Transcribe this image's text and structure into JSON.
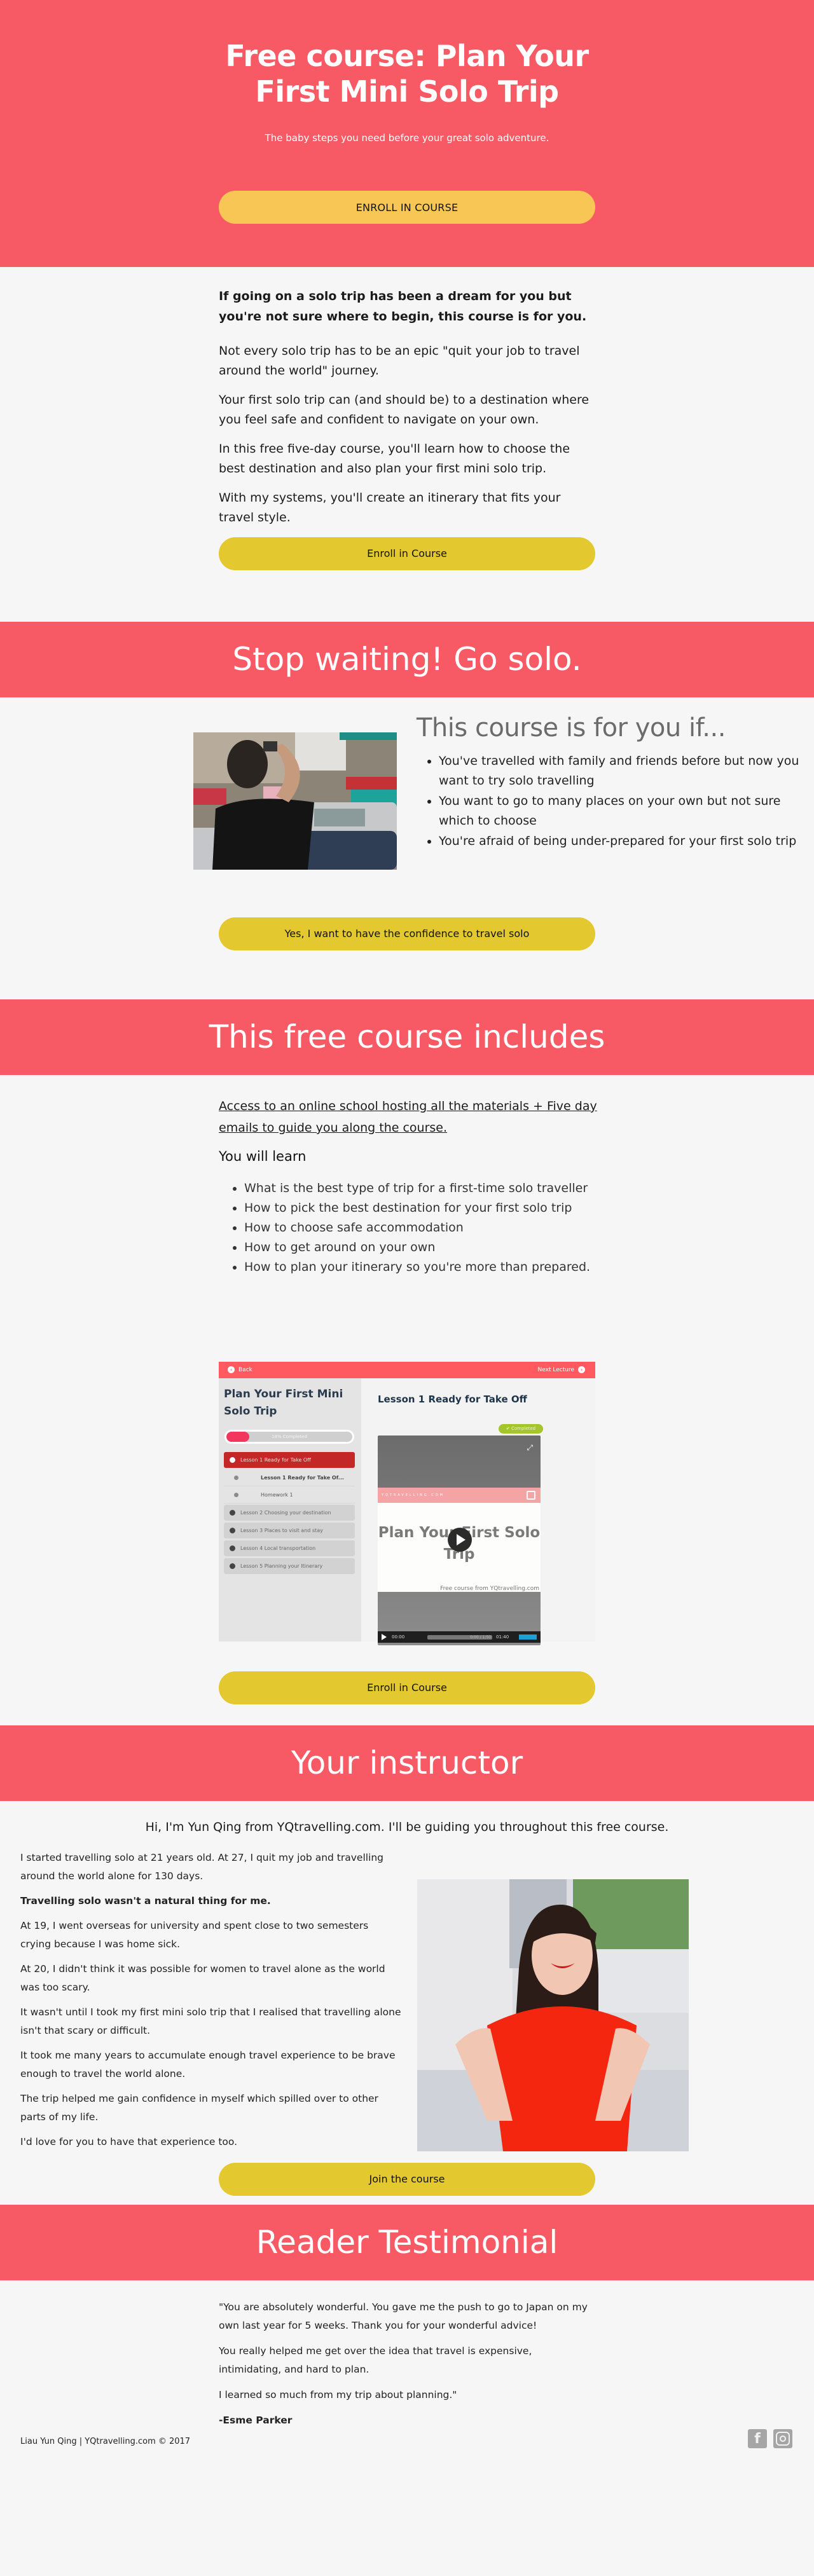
{
  "colors": {
    "brand_coral": "#f75a64",
    "hero_button": "#f7c655",
    "cta_button": "#e4c82f",
    "background": "#f6f6f6"
  },
  "hero": {
    "title": "Free course: Plan Your First Mini Solo Trip",
    "subtitle": "The baby steps you need before your great solo adventure.",
    "cta_label": "ENROLL IN COURSE"
  },
  "intro": {
    "lead": "If going on a solo trip has been a dream for you but you're not sure where to begin, this course is for you.",
    "paragraphs": [
      "Not every solo trip has to be an epic \"quit your job to travel around the world\" journey.",
      "Your first solo trip can (and should be) to a destination where you feel safe and confident to navigate on your own.",
      "In this free five-day course, you'll learn how to choose the best destination and also plan your first mini solo trip.",
      "With my systems, you'll create an itinerary that fits your travel style."
    ],
    "cta_label": "Enroll in Course"
  },
  "banner_go_solo": {
    "title": "Stop waiting! Go solo."
  },
  "for_you": {
    "heading": "This course is for you if...",
    "items": [
      "You've travelled with family and friends before but now you want to try solo travelling",
      "You want to go to many places on your own but not sure which to choose",
      "You're afraid of being under-prepared for your first solo trip"
    ],
    "cta_label": "Yes, I want to have the confidence to travel solo"
  },
  "banner_includes": {
    "title": "This free course includes"
  },
  "includes": {
    "access_text": "Access to an online school hosting all the materials + Five day emails to guide you along the course.",
    "learn_heading": "You will learn",
    "learn_items": [
      "What is the best type of trip for a first-time solo traveller",
      "How to pick the best destination for your first solo trip",
      "How to choose safe accommodation",
      "How to get around on your own",
      "How to plan your itinerary so you're more than prepared."
    ],
    "cta_label": "Enroll in Course",
    "mockup": {
      "back_label": "Back",
      "next_label": "Next Lecture",
      "course_title": "Plan Your First Mini Solo Trip",
      "progress_percent": 18,
      "progress_label": "18% Completed",
      "sections": [
        {
          "label": "Lesson 1 Ready for Take Off",
          "active": true
        },
        {
          "label": "Lesson 2 Choosing your destination",
          "active": false
        },
        {
          "label": "Lesson 3 Places to visit and stay",
          "active": false
        },
        {
          "label": "Lesson 4 Local transportation",
          "active": false
        },
        {
          "label": "Lesson 5 Planning your Itinerary",
          "active": false
        }
      ],
      "sub_items": [
        "Lesson 1 Ready for Take Of...",
        "Homework 1"
      ],
      "lesson_title": "Lesson 1 Ready for Take Off",
      "completed_badge": "✔ Completed",
      "video_brand": "YQTRAVELLING.COM",
      "video_title": "Plan Your First Solo Trip",
      "video_credit": "Free course from YQtravelling.com",
      "time_current": "00:00",
      "time_progress": "0:00 / 1:50",
      "volume_time": "01:40"
    }
  },
  "banner_instructor": {
    "title": "Your instructor"
  },
  "instructor": {
    "intro": "Hi, I'm Yun Qing from YQtravelling.com. I'll be guiding you throughout this free course.",
    "paragraphs": [
      {
        "text": "I started travelling solo at 21 years old. At 27, I quit my job and travelling around the world alone for 130 days.",
        "bold": false
      },
      {
        "text": "Travelling solo wasn't a natural thing for me.",
        "bold": true
      },
      {
        "text": "At 19, I went overseas for university and spent close to two semesters crying because I was home sick.",
        "bold": false
      },
      {
        "text": "At 20, I didn't think it was possible for women to travel alone as the world was too scary.",
        "bold": false
      },
      {
        "text": "It wasn't until I took my first mini solo trip that I realised that travelling alone isn't that scary or difficult.",
        "bold": false
      },
      {
        "text": "It took me many years to accumulate enough travel experience to be brave enough to travel the world alone.",
        "bold": false
      },
      {
        "text": "The trip helped me gain confidence in myself which spilled over to other parts of my life.",
        "bold": false
      },
      {
        "text": "I'd love for you to have that experience too.",
        "bold": false
      }
    ],
    "cta_label": "Join the course"
  },
  "banner_testimonial": {
    "title": "Reader Testimonial"
  },
  "testimonial": {
    "paragraphs": [
      "\"You are absolutely wonderful. You gave me the push to go to Japan on my own last year for 5 weeks. Thank you for your wonderful advice!",
      "You really helped me get over the idea that travel is expensive, intimidating, and hard to plan.",
      "I learned so much from my trip about planning.\""
    ],
    "author": "-Esme Parker"
  },
  "footer": {
    "copyright": "Liau Yun Qing | YQtravelling.com © 2017",
    "social": [
      {
        "icon": "facebook-icon",
        "glyph": "f"
      },
      {
        "icon": "instagram-icon",
        "glyph": ""
      }
    ]
  }
}
